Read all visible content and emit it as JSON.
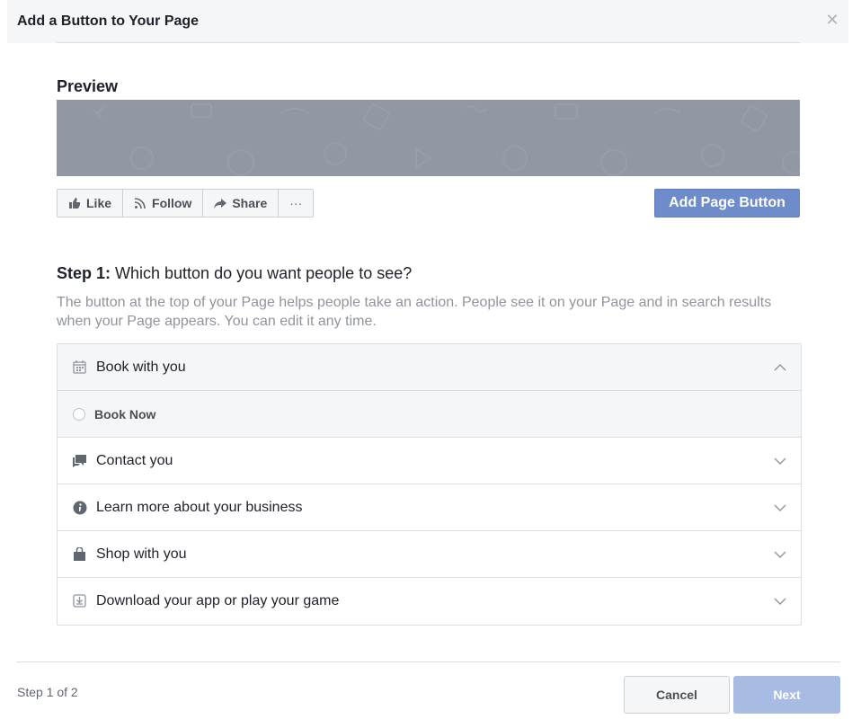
{
  "dialog": {
    "title": "Add a Button to Your Page",
    "close_icon": "close-icon"
  },
  "preview": {
    "label": "Preview",
    "actions": [
      {
        "label": "Like",
        "icon": "thumbs-up-icon"
      },
      {
        "label": "Follow",
        "icon": "rss-icon"
      },
      {
        "label": "Share",
        "icon": "share-arrow-icon"
      },
      {
        "label": "···",
        "icon": "more-icon"
      }
    ],
    "add_button_label": "Add Page Button",
    "colors": {
      "cover": "#9197a3",
      "add_button": "#6d8cc9"
    }
  },
  "step": {
    "heading_bold": "Step 1:",
    "heading_text": " Which button do you want people to see?",
    "description": "The button at the top of your Page helps people take an action. People see it on your Page and in search results when your Page appears. You can edit it any time."
  },
  "options": [
    {
      "label": "Book with you",
      "icon": "calendar-icon",
      "expanded": true,
      "choices": [
        {
          "label": "Book Now",
          "selected": false
        }
      ]
    },
    {
      "label": "Contact you",
      "icon": "chat-icon",
      "expanded": false
    },
    {
      "label": "Learn more about your business",
      "icon": "info-icon",
      "expanded": false
    },
    {
      "label": "Shop with you",
      "icon": "shopping-bag-icon",
      "expanded": false
    },
    {
      "label": "Download your app or play your game",
      "icon": "download-icon",
      "expanded": false
    }
  ],
  "footer": {
    "step_count": "Step 1 of 2",
    "cancel_label": "Cancel",
    "next_label": "Next",
    "next_color": "#a8bce3"
  }
}
